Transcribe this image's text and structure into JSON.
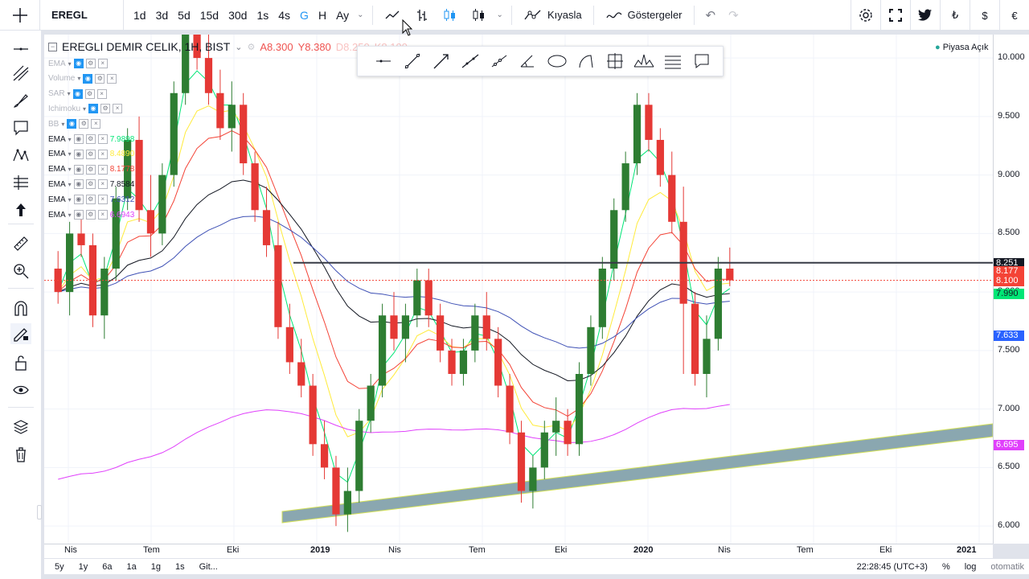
{
  "symbol": "EREGL",
  "intervals": [
    "1d",
    "3d",
    "5d",
    "15d",
    "30d",
    "1s",
    "4s",
    "G",
    "H",
    "Ay"
  ],
  "active_interval": "G",
  "toolbar": {
    "compare": "Kıyasla",
    "indicators": "Göstergeler"
  },
  "currencies": [
    "₺",
    "$",
    "€"
  ],
  "legend": {
    "title": "EREGLI DEMIR CELIK, 1H, BIST",
    "open": "A8.300",
    "high": "Y8.380",
    "low": "D8.250",
    "close": "K8.100"
  },
  "indicators": [
    {
      "name": "EMA",
      "value": ""
    },
    {
      "name": "Volume",
      "value": ""
    },
    {
      "name": "SAR",
      "value": ""
    },
    {
      "name": "Ichimoku",
      "value": ""
    },
    {
      "name": "BB",
      "value": ""
    },
    {
      "name": "EMA",
      "value": "7.9898",
      "color": "#00e676"
    },
    {
      "name": "EMA",
      "value": "8.4890",
      "color": "#ffeb3b"
    },
    {
      "name": "EMA",
      "value": "8.1778",
      "color": "#f44336"
    },
    {
      "name": "EMA",
      "value": "7.8584",
      "color": "#131722"
    },
    {
      "name": "EMA",
      "value": "7.6312",
      "color": "#3f51b5"
    },
    {
      "name": "EMA",
      "value": "6.6943",
      "color": "#e040fb"
    }
  ],
  "market_status": "Piyasa Açık",
  "price_ticks": [
    "10.000",
    "9.500",
    "9.000",
    "8.500",
    "8.000",
    "7.500",
    "7.000",
    "6.500",
    "6.000"
  ],
  "price_labels": [
    {
      "value": "8.251",
      "bg": "#131722",
      "fg": "#ffffff"
    },
    {
      "value": "8.177",
      "bg": "#f44336",
      "fg": "#ffffff"
    },
    {
      "value": "8.100",
      "bg": "#f44336",
      "fg": "#ffffff"
    },
    {
      "value": "7.990",
      "bg": "#00e676",
      "fg": "#131722"
    },
    {
      "value": "7.633",
      "bg": "#2962ff",
      "fg": "#ffffff"
    },
    {
      "value": "6.695",
      "bg": "#e040fb",
      "fg": "#ffffff"
    }
  ],
  "time_ticks": [
    "Nis",
    "Tem",
    "Eki",
    "2019",
    "Nis",
    "Tem",
    "Eki",
    "2020",
    "Nis",
    "Tem",
    "Eki",
    "2021"
  ],
  "ranges": [
    "5y",
    "1y",
    "6a",
    "1a",
    "1g",
    "1s",
    "Git..."
  ],
  "clock": "22:28:45 (UTC+3)",
  "bottom_opts": [
    "%",
    "log",
    "otomatik"
  ],
  "chart_data": {
    "type": "candlestick",
    "series_note": "",
    "ylim": [
      5.85,
      10.2
    ],
    "candles": [
      [
        8.2,
        8.35,
        7.9,
        8.0
      ],
      [
        8.0,
        8.6,
        7.8,
        8.5
      ],
      [
        8.5,
        8.7,
        8.3,
        8.4
      ],
      [
        8.4,
        8.5,
        7.7,
        7.8
      ],
      [
        7.8,
        8.3,
        7.6,
        8.2
      ],
      [
        8.2,
        8.9,
        8.1,
        8.8
      ],
      [
        8.8,
        9.4,
        8.7,
        9.3
      ],
      [
        9.3,
        9.5,
        8.6,
        8.7
      ],
      [
        8.7,
        9.0,
        8.3,
        8.5
      ],
      [
        8.5,
        9.1,
        8.4,
        9.0
      ],
      [
        9.0,
        9.8,
        8.9,
        9.7
      ],
      [
        9.7,
        10.4,
        9.6,
        10.3
      ],
      [
        10.3,
        10.6,
        9.9,
        10.0
      ],
      [
        10.0,
        10.5,
        9.6,
        9.7
      ],
      [
        9.7,
        9.9,
        9.3,
        9.4
      ],
      [
        9.4,
        9.8,
        9.2,
        9.6
      ],
      [
        9.6,
        9.7,
        9.0,
        9.1
      ],
      [
        9.1,
        9.2,
        8.6,
        8.7
      ],
      [
        8.7,
        8.9,
        8.3,
        8.4
      ],
      [
        8.4,
        8.6,
        7.6,
        7.7
      ],
      [
        7.7,
        7.9,
        7.3,
        7.4
      ],
      [
        7.4,
        7.6,
        7.1,
        7.2
      ],
      [
        7.2,
        7.3,
        6.6,
        6.7
      ],
      [
        6.7,
        6.9,
        6.4,
        6.5
      ],
      [
        6.5,
        6.6,
        6.0,
        6.1
      ],
      [
        6.1,
        6.5,
        5.95,
        6.3
      ],
      [
        6.3,
        7.0,
        6.2,
        6.9
      ],
      [
        6.9,
        7.3,
        6.8,
        7.2
      ],
      [
        7.2,
        7.9,
        7.1,
        7.8
      ],
      [
        7.8,
        8.0,
        7.5,
        7.6
      ],
      [
        7.6,
        7.9,
        7.4,
        7.8
      ],
      [
        7.8,
        8.2,
        7.7,
        8.1
      ],
      [
        8.1,
        8.2,
        7.7,
        7.8
      ],
      [
        7.8,
        7.9,
        7.4,
        7.5
      ],
      [
        7.5,
        7.6,
        7.2,
        7.3
      ],
      [
        7.3,
        7.6,
        7.2,
        7.5
      ],
      [
        7.5,
        7.9,
        7.4,
        7.8
      ],
      [
        7.8,
        8.0,
        7.5,
        7.6
      ],
      [
        7.6,
        7.7,
        7.1,
        7.2
      ],
      [
        7.2,
        7.3,
        6.7,
        6.8
      ],
      [
        6.8,
        6.9,
        6.2,
        6.3
      ],
      [
        6.3,
        6.6,
        6.15,
        6.5
      ],
      [
        6.5,
        6.9,
        6.4,
        6.8
      ],
      [
        6.8,
        7.1,
        6.6,
        6.9
      ],
      [
        6.9,
        7.0,
        6.6,
        6.7
      ],
      [
        6.7,
        7.4,
        6.6,
        7.3
      ],
      [
        7.3,
        7.8,
        7.2,
        7.7
      ],
      [
        7.7,
        8.3,
        7.6,
        8.2
      ],
      [
        8.2,
        8.8,
        8.1,
        8.7
      ],
      [
        8.7,
        9.2,
        8.6,
        9.1
      ],
      [
        9.1,
        9.7,
        9.0,
        9.6
      ],
      [
        9.6,
        9.7,
        9.2,
        9.3
      ],
      [
        9.3,
        9.4,
        8.9,
        9.0
      ],
      [
        9.0,
        9.2,
        8.5,
        8.6
      ],
      [
        8.6,
        8.9,
        7.3,
        7.9
      ],
      [
        7.9,
        8.0,
        7.2,
        7.3
      ],
      [
        7.3,
        7.8,
        7.1,
        7.6
      ],
      [
        7.6,
        8.3,
        7.5,
        8.2
      ],
      [
        8.2,
        8.38,
        8.05,
        8.1
      ]
    ],
    "horizontal_line": 8.25,
    "dotted_line": 8.1
  }
}
